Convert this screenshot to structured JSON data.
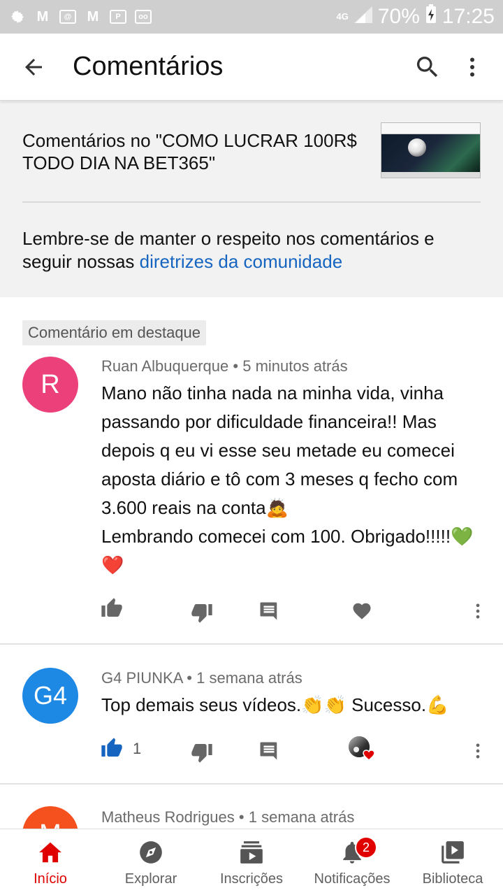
{
  "status_bar": {
    "network": "4G",
    "battery": "70%",
    "time": "17:25"
  },
  "app_bar": {
    "title": "Comentários"
  },
  "header": {
    "video_title": "Comentários no \"COMO LUCRAR 100R$ TODO DIA NA BET365\"",
    "guidelines_text": "Lembre-se de manter o respeito nos comentários e seguir nossas ",
    "guidelines_link": "diretrizes da comunidade"
  },
  "comments": [
    {
      "featured_label": "Comentário em destaque",
      "avatar_letter": "R",
      "avatar_color": "#ec407a",
      "author": "Ruan Albuquerque",
      "time": "5 minutos atrás",
      "text": "Mano não tinha nada na minha vida, vinha passando por dificuldade financeira!! Mas depois q eu vi esse seu metade eu comecei aposta diário e tô com 3 meses q fecho com 3.600 reais na conta🙇\nLembrando comecei com 100. Obrigado!!!!!💚❤️"
    },
    {
      "avatar_letter": "G4",
      "avatar_color": "#1e88e5",
      "author": "G4 PIUNKA",
      "time": "1 semana atrás",
      "text": "Top demais seus vídeos.👏👏 Sucesso.💪",
      "likes": "1"
    },
    {
      "avatar_letter": "M",
      "avatar_color": "#f4511e",
      "author": "Matheus Rodrigues",
      "time": "1 semana atrás"
    }
  ],
  "bottom_nav": {
    "items": [
      {
        "label": "Início",
        "icon": "home-icon",
        "active": true
      },
      {
        "label": "Explorar",
        "icon": "compass-icon"
      },
      {
        "label": "Inscrições",
        "icon": "subscriptions-icon"
      },
      {
        "label": "Notificações",
        "icon": "bell-icon",
        "badge": "2"
      },
      {
        "label": "Biblioteca",
        "icon": "library-icon"
      }
    ]
  },
  "colors": {
    "accent_red": "#e00000",
    "link_blue": "#1565c0",
    "liked_blue": "#1565c0"
  }
}
